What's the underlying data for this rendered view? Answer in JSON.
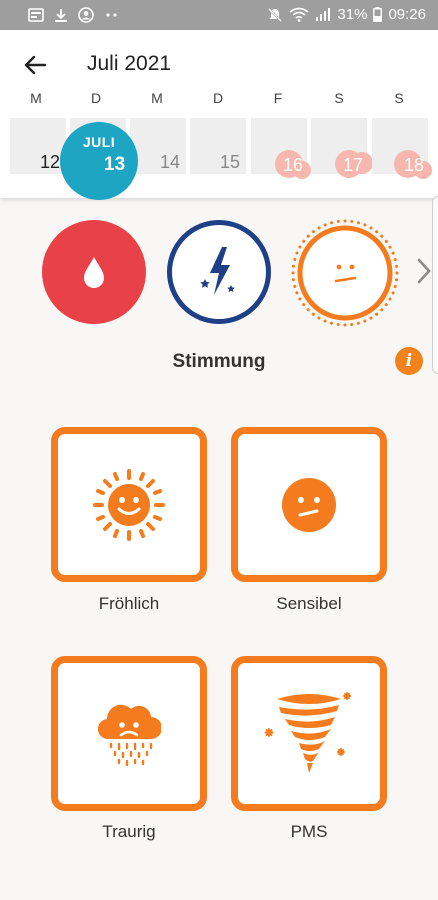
{
  "status_bar": {
    "battery": "31%",
    "time": "09:26",
    "icons": [
      "news-icon",
      "download-icon",
      "account-icon",
      "more-dots-icon",
      "mute-icon",
      "wifi-icon",
      "signal-icon",
      "battery-icon"
    ]
  },
  "header": {
    "title": "Juli 2021",
    "weekdays": [
      "M",
      "D",
      "M",
      "D",
      "F",
      "S",
      "S"
    ],
    "days": [
      "12",
      "13",
      "14",
      "15",
      "16",
      "17",
      "18"
    ],
    "today": {
      "month": "JULI",
      "day": "13"
    },
    "colors": {
      "today": "#1ea5c3",
      "period_forecast": "#f7b7ae"
    }
  },
  "categories": [
    {
      "name": "blood",
      "icon": "drop-icon",
      "color": "#e84147"
    },
    {
      "name": "energy",
      "icon": "lightning-icon",
      "color": "#1f3f86"
    },
    {
      "name": "mood",
      "icon": "mood-sun-icon",
      "color": "#f47c1e",
      "selected": true
    }
  ],
  "section": {
    "title": "Stimmung",
    "info": "i"
  },
  "moods": [
    {
      "label": "Fröhlich",
      "icon": "happy-sun-icon"
    },
    {
      "label": "Sensibel",
      "icon": "confused-face-icon"
    },
    {
      "label": "Traurig",
      "icon": "sad-cloud-icon"
    },
    {
      "label": "PMS",
      "icon": "tornado-icon"
    }
  ],
  "accent": "#f47c1e"
}
